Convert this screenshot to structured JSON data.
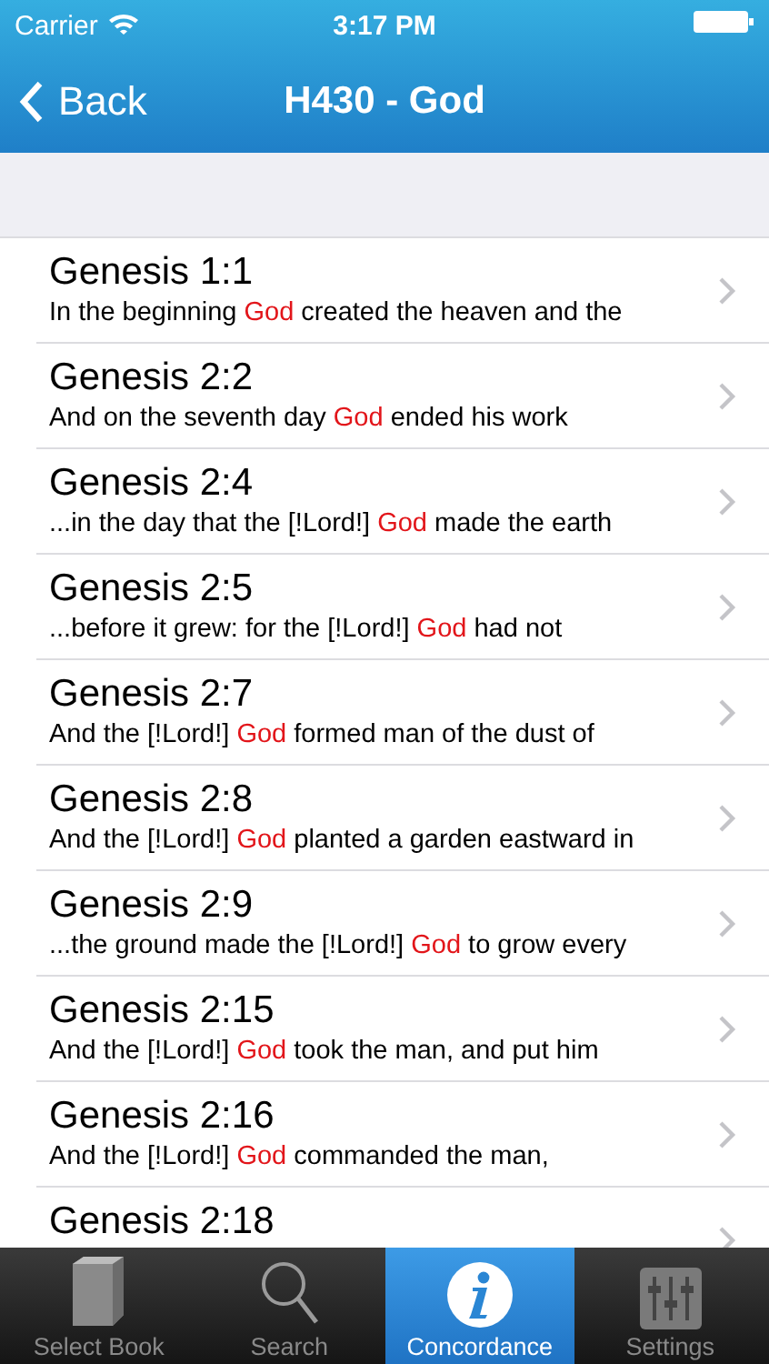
{
  "status_bar": {
    "carrier": "Carrier",
    "time": "3:17 PM"
  },
  "nav": {
    "back": "Back",
    "title": "H430 - God"
  },
  "results": [
    {
      "reference": "Genesis 1:1",
      "verse": {
        "before": "In the beginning ",
        "highlight": "God",
        "after": " created the heaven and the"
      }
    },
    {
      "reference": "Genesis 2:2",
      "verse": {
        "before": "And on the seventh day ",
        "highlight": "God",
        "after": " ended his work"
      }
    },
    {
      "reference": "Genesis 2:4",
      "verse": {
        "before": "...in the day that the [!Lord!] ",
        "highlight": "God",
        "after": " made the earth"
      }
    },
    {
      "reference": "Genesis 2:5",
      "verse": {
        "before": "...before it grew: for the [!Lord!] ",
        "highlight": "God",
        "after": " had not"
      }
    },
    {
      "reference": "Genesis 2:7",
      "verse": {
        "before": "And the [!Lord!] ",
        "highlight": "God",
        "after": " formed man of the dust of"
      }
    },
    {
      "reference": "Genesis 2:8",
      "verse": {
        "before": "And the [!Lord!] ",
        "highlight": "God",
        "after": " planted a garden eastward in"
      }
    },
    {
      "reference": "Genesis 2:9",
      "verse": {
        "before": "...the ground made the [!Lord!] ",
        "highlight": "God",
        "after": " to grow every"
      }
    },
    {
      "reference": "Genesis 2:15",
      "verse": {
        "before": "And the [!Lord!] ",
        "highlight": "God",
        "after": " took the man, and put him"
      }
    },
    {
      "reference": "Genesis 2:16",
      "verse": {
        "before": "And the [!Lord!] ",
        "highlight": "God",
        "after": " commanded the man,"
      }
    },
    {
      "reference": "Genesis 2:18"
    }
  ],
  "tab_bar": [
    {
      "kind": "book",
      "label": "Select Book",
      "selected": false
    },
    {
      "kind": "search",
      "label": "Search",
      "selected": false
    },
    {
      "kind": "info",
      "label": "Concordance",
      "selected": true
    },
    {
      "kind": "settings",
      "label": "Settings",
      "selected": false
    }
  ]
}
